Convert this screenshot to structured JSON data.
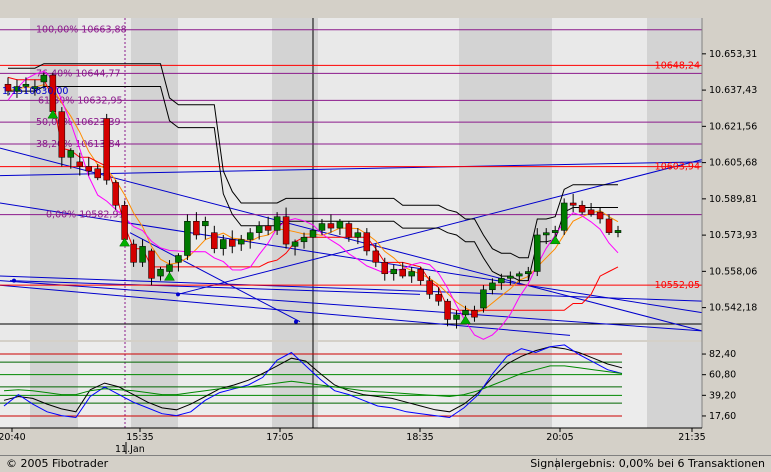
{
  "footer": {
    "copyright": "© 2005 Fibotrader",
    "status": "Signalergebnis: 0,00% bei 6 Transaktionen"
  },
  "colors": {
    "background": "#e9e9e9",
    "panel_bg": "#ececec",
    "session_band": "#d3d3d3",
    "fib_line": "#8b1a8b",
    "red_line": "#ff0000",
    "candle_up": "#007a00",
    "candle_down": "#d40000",
    "trend_line": "#0000cc",
    "envelope": "#000000",
    "signal_arrow": "#00b000"
  },
  "chart_data": [
    {
      "type": "candlestick",
      "panel": "price",
      "y_axis": {
        "range": [
          10528,
          10669
        ],
        "ticks": [
          "10.653,31",
          "10.637,43",
          "10.621,56",
          "10.605,68",
          "10.589,81",
          "10.573,93",
          "10.558,06",
          "10.542,18"
        ]
      },
      "x_axis": {
        "ticks": [
          "20:40",
          "15:35",
          "17:05",
          "18:35",
          "20:05",
          "21:35"
        ],
        "date_label": "11.Jan"
      },
      "fib_levels": [
        {
          "label": "100,00% 10663,88",
          "value": 10663.88
        },
        {
          "label": "76,40% 10644,77",
          "value": 10644.77
        },
        {
          "label": "61,80% 10632,95",
          "value": 10632.95
        },
        {
          "label": "50,00% 10623,39",
          "value": 10623.39
        },
        {
          "label": "38,20% 10613,84",
          "value": 10613.84
        },
        {
          "label": "0,00% 10582,91",
          "value": 10582.91
        }
      ],
      "level_labels": [
        {
          "label": "10648,24",
          "value": 10648.24
        },
        {
          "label": "10603,94",
          "value": 10603.94
        },
        {
          "label": "10552,05",
          "value": 10552.05
        }
      ],
      "cursor_label": "1,1510630,00",
      "candles": [
        {
          "o": 10640,
          "h": 10643,
          "l": 10635,
          "c": 10637
        },
        {
          "o": 10637,
          "h": 10642,
          "l": 10634,
          "c": 10639
        },
        {
          "o": 10639,
          "h": 10643,
          "l": 10636,
          "c": 10640
        },
        {
          "o": 10638,
          "h": 10642,
          "l": 10635,
          "c": 10639
        },
        {
          "o": 10641,
          "h": 10645,
          "l": 10638,
          "c": 10644
        },
        {
          "o": 10644,
          "h": 10645,
          "l": 10626,
          "c": 10628
        },
        {
          "o": 10628,
          "h": 10630,
          "l": 10604,
          "c": 10608
        },
        {
          "o": 10608,
          "h": 10612,
          "l": 10603,
          "c": 10611
        },
        {
          "o": 10606,
          "h": 10610,
          "l": 10600,
          "c": 10604
        },
        {
          "o": 10604,
          "h": 10608,
          "l": 10600,
          "c": 10602
        },
        {
          "o": 10603,
          "h": 10605,
          "l": 10598,
          "c": 10599
        },
        {
          "o": 10625,
          "h": 10627,
          "l": 10596,
          "c": 10598
        },
        {
          "o": 10597,
          "h": 10598,
          "l": 10585,
          "c": 10587
        },
        {
          "o": 10587,
          "h": 10589,
          "l": 10570,
          "c": 10572
        },
        {
          "o": 10570,
          "h": 10572,
          "l": 10560,
          "c": 10562
        },
        {
          "o": 10562,
          "h": 10572,
          "l": 10560,
          "c": 10569
        },
        {
          "o": 10567,
          "h": 10568,
          "l": 10552,
          "c": 10555
        },
        {
          "o": 10556,
          "h": 10560,
          "l": 10554,
          "c": 10559
        },
        {
          "o": 10558,
          "h": 10563,
          "l": 10555,
          "c": 10561
        },
        {
          "o": 10562,
          "h": 10566,
          "l": 10558,
          "c": 10565
        },
        {
          "o": 10565,
          "h": 10583,
          "l": 10563,
          "c": 10580
        },
        {
          "o": 10580,
          "h": 10584,
          "l": 10572,
          "c": 10574
        },
        {
          "o": 10578,
          "h": 10582,
          "l": 10572,
          "c": 10580
        },
        {
          "o": 10575,
          "h": 10578,
          "l": 10566,
          "c": 10568
        },
        {
          "o": 10568,
          "h": 10574,
          "l": 10565,
          "c": 10572
        },
        {
          "o": 10572,
          "h": 10576,
          "l": 10566,
          "c": 10569
        },
        {
          "o": 10570,
          "h": 10574,
          "l": 10567,
          "c": 10572
        },
        {
          "o": 10572,
          "h": 10577,
          "l": 10568,
          "c": 10575
        },
        {
          "o": 10575,
          "h": 10580,
          "l": 10572,
          "c": 10578
        },
        {
          "o": 10578,
          "h": 10582,
          "l": 10574,
          "c": 10576
        },
        {
          "o": 10576,
          "h": 10584,
          "l": 10574,
          "c": 10582
        },
        {
          "o": 10582,
          "h": 10586,
          "l": 10568,
          "c": 10570
        },
        {
          "o": 10569,
          "h": 10572,
          "l": 10565,
          "c": 10571
        },
        {
          "o": 10571,
          "h": 10575,
          "l": 10568,
          "c": 10573
        },
        {
          "o": 10573,
          "h": 10578,
          "l": 10570,
          "c": 10576
        },
        {
          "o": 10576,
          "h": 10581,
          "l": 10574,
          "c": 10579
        },
        {
          "o": 10579,
          "h": 10583,
          "l": 10575,
          "c": 10577
        },
        {
          "o": 10577,
          "h": 10581,
          "l": 10574,
          "c": 10580
        },
        {
          "o": 10579,
          "h": 10580,
          "l": 10571,
          "c": 10573
        },
        {
          "o": 10573,
          "h": 10577,
          "l": 10570,
          "c": 10575
        },
        {
          "o": 10575,
          "h": 10577,
          "l": 10565,
          "c": 10567
        },
        {
          "o": 10567,
          "h": 10570,
          "l": 10560,
          "c": 10562
        },
        {
          "o": 10562,
          "h": 10564,
          "l": 10554,
          "c": 10557
        },
        {
          "o": 10557,
          "h": 10561,
          "l": 10554,
          "c": 10559
        },
        {
          "o": 10559,
          "h": 10562,
          "l": 10555,
          "c": 10556
        },
        {
          "o": 10556,
          "h": 10560,
          "l": 10553,
          "c": 10558
        },
        {
          "o": 10559,
          "h": 10560,
          "l": 10552,
          "c": 10554
        },
        {
          "o": 10554,
          "h": 10556,
          "l": 10546,
          "c": 10548
        },
        {
          "o": 10548,
          "h": 10551,
          "l": 10543,
          "c": 10545
        },
        {
          "o": 10545,
          "h": 10546,
          "l": 10534,
          "c": 10537
        },
        {
          "o": 10537,
          "h": 10541,
          "l": 10533,
          "c": 10539
        },
        {
          "o": 10539,
          "h": 10543,
          "l": 10536,
          "c": 10541
        },
        {
          "o": 10541,
          "h": 10543,
          "l": 10536,
          "c": 10538
        },
        {
          "o": 10542,
          "h": 10552,
          "l": 10540,
          "c": 10550
        },
        {
          "o": 10550,
          "h": 10555,
          "l": 10548,
          "c": 10553
        },
        {
          "o": 10553,
          "h": 10557,
          "l": 10550,
          "c": 10555
        },
        {
          "o": 10555,
          "h": 10558,
          "l": 10552,
          "c": 10556
        },
        {
          "o": 10556,
          "h": 10558,
          "l": 10553,
          "c": 10557
        },
        {
          "o": 10557,
          "h": 10560,
          "l": 10554,
          "c": 10558
        },
        {
          "o": 10558,
          "h": 10577,
          "l": 10556,
          "c": 10574
        },
        {
          "o": 10574,
          "h": 10577,
          "l": 10570,
          "c": 10575
        },
        {
          "o": 10575,
          "h": 10578,
          "l": 10571,
          "c": 10576
        },
        {
          "o": 10576,
          "h": 10590,
          "l": 10574,
          "c": 10588
        },
        {
          "o": 10588,
          "h": 10592,
          "l": 10584,
          "c": 10587
        },
        {
          "o": 10587,
          "h": 10589,
          "l": 10583,
          "c": 10584
        },
        {
          "o": 10585,
          "h": 10588,
          "l": 10582,
          "c": 10583
        },
        {
          "o": 10584,
          "h": 10586,
          "l": 10579,
          "c": 10581
        },
        {
          "o": 10581,
          "h": 10583,
          "l": 10574,
          "c": 10575
        },
        {
          "o": 10575,
          "h": 10578,
          "l": 10573,
          "c": 10576
        }
      ],
      "signals": [
        {
          "candle": 5,
          "dir": "up"
        },
        {
          "candle": 13,
          "dir": "up"
        },
        {
          "candle": 18,
          "dir": "up"
        },
        {
          "candle": 51,
          "dir": "up"
        },
        {
          "candle": 61,
          "dir": "up"
        }
      ]
    },
    {
      "type": "line",
      "panel": "oscillator",
      "y_axis": {
        "range": [
          5,
          95
        ],
        "ticks": [
          "82,40",
          "60,80",
          "39,20",
          "17,60"
        ]
      },
      "levels": [
        82.4,
        74,
        60.8,
        48,
        39.2,
        31,
        17.6
      ],
      "series": [
        {
          "color": "#000000",
          "values": [
            34,
            38,
            36,
            30,
            25,
            22,
            45,
            52,
            48,
            40,
            32,
            26,
            24,
            30,
            38,
            46,
            50,
            55,
            62,
            70,
            78,
            75,
            62,
            50,
            44,
            40,
            38,
            36,
            32,
            28,
            24,
            22,
            30,
            42,
            58,
            72,
            80,
            86,
            90,
            88,
            84,
            78,
            72,
            68
          ]
        },
        {
          "color": "#0000ff",
          "values": [
            28,
            40,
            30,
            22,
            18,
            16,
            38,
            48,
            40,
            32,
            26,
            20,
            18,
            22,
            34,
            42,
            46,
            50,
            58,
            76,
            84,
            70,
            56,
            44,
            40,
            34,
            28,
            26,
            22,
            20,
            18,
            16,
            26,
            40,
            62,
            80,
            88,
            84,
            90,
            92,
            82,
            74,
            66,
            62
          ]
        },
        {
          "color": "#008800",
          "values": [
            44,
            45,
            44,
            42,
            40,
            40,
            44,
            46,
            45,
            44,
            42,
            40,
            40,
            42,
            44,
            46,
            47,
            48,
            50,
            52,
            54,
            52,
            50,
            48,
            46,
            44,
            43,
            42,
            41,
            40,
            39,
            38,
            40,
            44,
            50,
            56,
            62,
            66,
            70,
            70,
            68,
            66,
            64,
            62
          ]
        }
      ]
    }
  ]
}
